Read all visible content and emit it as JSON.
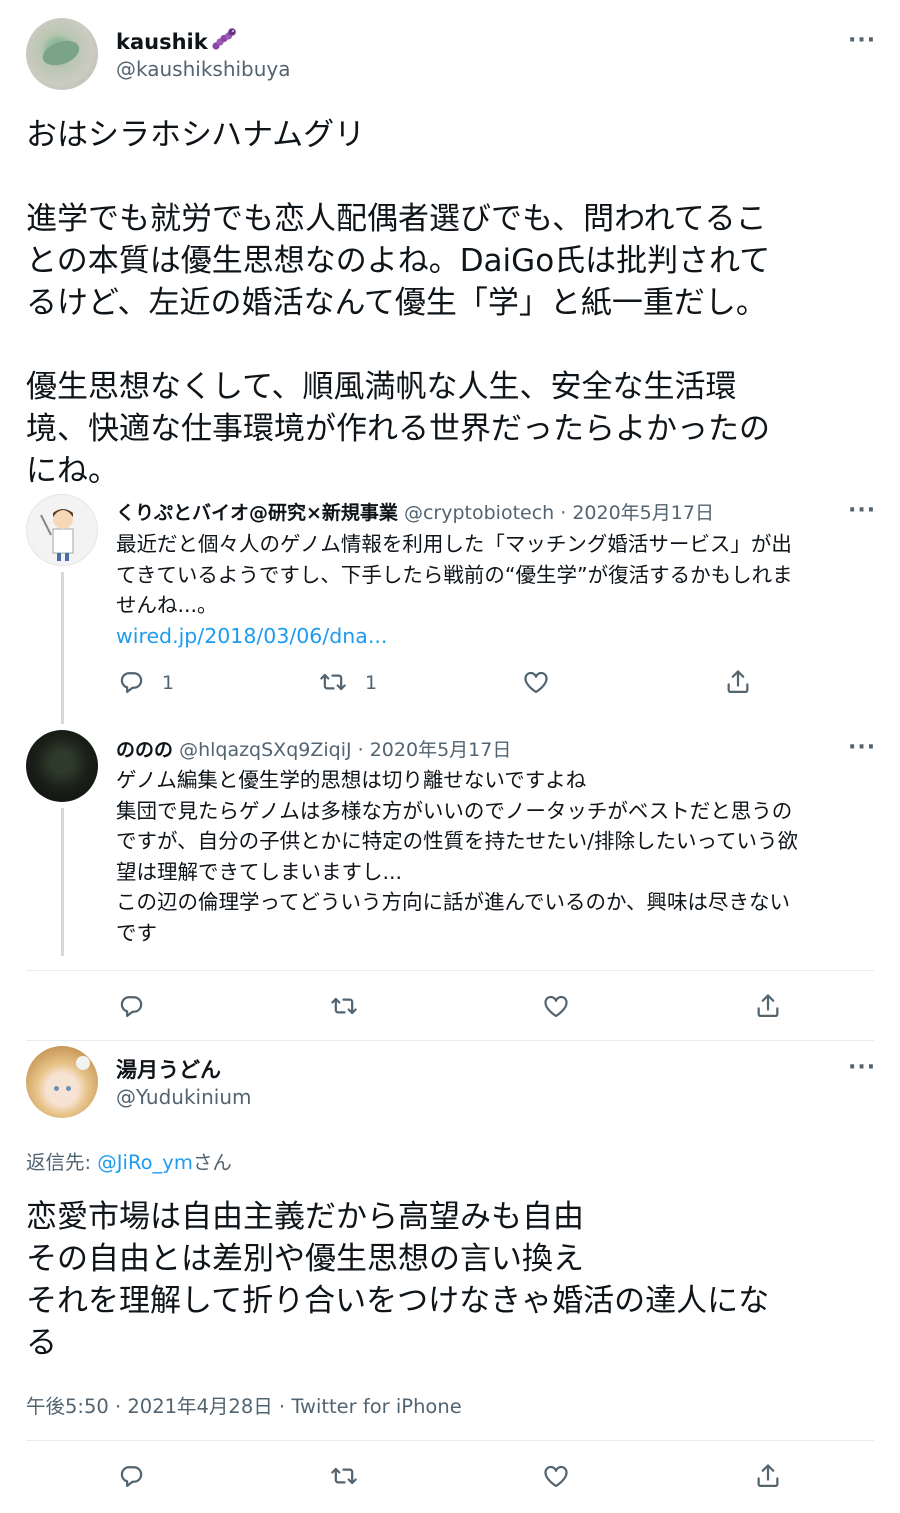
{
  "main_tweet": {
    "display_name": "kaushik",
    "display_name_emoji": "caterpillar-icon",
    "handle": "@kaushikshibuya",
    "lines": [
      "おはシラホシハナムグリ",
      "",
      "進学でも就労でも恋人配偶者選びでも、問われてるこ",
      "との本質は優生思想なのよね。DaiGo氏は批判されて",
      "るけど、左近の婚活なんて優生「学」と紙一重だし。",
      "",
      "優生思想なくして、順風満帆な人生、安全な生活環",
      "境、快適な仕事環境が作れる世界だったらよかったの",
      "にね。"
    ]
  },
  "thread": [
    {
      "display_name": "くりぷとバイオ@研究×新規事業",
      "handle": "@cryptobiotech",
      "date": "· 2020年5月17日",
      "lines": [
        "最近だと個々人のゲノム情報を利用した「マッチング婚活サービス」が出",
        "てきているようですし、下手したら戦前の“優生学”が復活するかもしれま",
        "せんね...。"
      ],
      "link": "wired.jp/2018/03/06/dna...",
      "reply_count": "1",
      "retweet_count": "1"
    },
    {
      "display_name": "ののの",
      "handle": "@hlqazqSXq9ZiqiJ",
      "date": "· 2020年5月17日",
      "lines": [
        "ゲノム編集と優生学的思想は切り離せないですよね",
        "集団で見たらゲノムは多様な方がいいのでノータッチがベストだと思うの",
        "ですが、自分の子供とかに特定の性質を持たせたい/排除したいっていう欲",
        "望は理解できてしまいますし...",
        "この辺の倫理学ってどういう方向に話が進んでいるのか、興味は尽きない",
        "です"
      ]
    }
  ],
  "reply_tweet": {
    "display_name": "湯月うどん",
    "handle": "@Yudukinium",
    "reply_to_prefix": "返信先: ",
    "reply_to_handle": "@JiRo_ym",
    "reply_to_suffix": "さん",
    "lines": [
      "恋愛市場は自由主義だから高望みも自由",
      "その自由とは差別や優生思想の言い換え",
      "それを理解して折り合いをつけなきゃ婚活の達人にな",
      "る"
    ],
    "timestamp": "午後5:50 · 2021年4月28日 · Twitter for iPhone"
  },
  "icons": [
    "more-icon",
    "reply-icon",
    "retweet-icon",
    "like-icon",
    "share-icon"
  ],
  "colors": {
    "text": "#0f1419",
    "secondary": "#536471",
    "link": "#1d9bf0",
    "thread_line": "#cfd9de"
  }
}
